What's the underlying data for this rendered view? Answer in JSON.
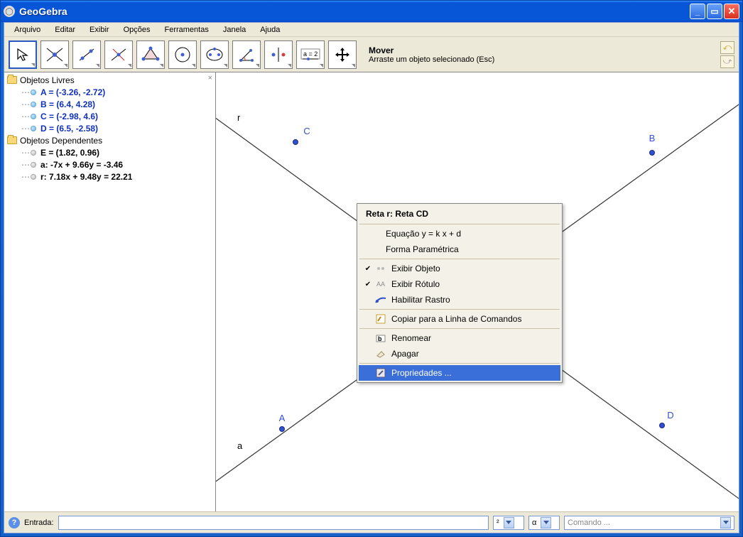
{
  "window": {
    "title": "GeoGebra"
  },
  "menus": {
    "file": "Arquivo",
    "edit": "Editar",
    "view": "Exibir",
    "options": "Opções",
    "tools": "Ferramentas",
    "window": "Janela",
    "help": "Ajuda"
  },
  "tool_info": {
    "title": "Mover",
    "desc": "Arraste um objeto selecionado (Esc)"
  },
  "sidebar": {
    "free_label": "Objetos Livres",
    "dep_label": "Objetos Dependentes",
    "A": "A = (-3.26, -2.72)",
    "B": "B = (6.4, 4.28)",
    "C": "C = (-2.98, 4.6)",
    "D": "D = (6.5, -2.58)",
    "E": "E = (1.82, 0.96)",
    "a": "a: -7x + 9.66y = -3.46",
    "r": "r: 7.18x + 9.48y = 22.21"
  },
  "canvas": {
    "labels": {
      "A": "A",
      "B": "B",
      "C": "C",
      "D": "D",
      "r": "r",
      "a": "a"
    }
  },
  "context": {
    "header": "Reta r: Reta CD",
    "eq": "Equação y = k x + d",
    "param": "Forma Paramétrica",
    "show_obj": "Exibir Objeto",
    "show_label": "Exibir Rótulo",
    "trace": "Habilitar Rastro",
    "copy": "Copiar para a Linha de Comandos",
    "rename": "Renomear",
    "delete": "Apagar",
    "props": "Propriedades ..."
  },
  "status": {
    "entry_label": "Entrada:",
    "sup": "²",
    "alpha": "α",
    "command": "Comando ..."
  }
}
